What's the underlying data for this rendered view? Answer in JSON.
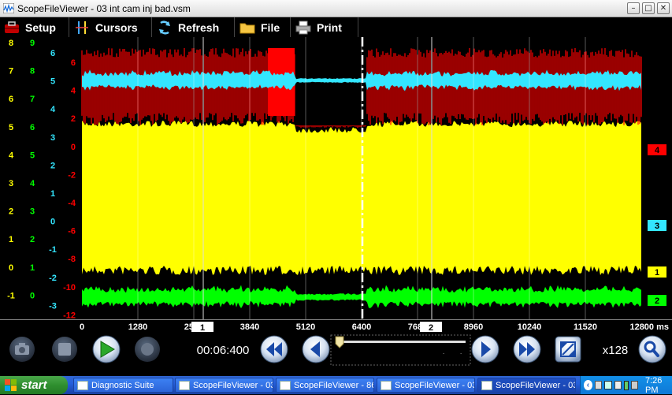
{
  "window": {
    "title": "ScopeFileViewer - 03 int cam inj bad.vsm"
  },
  "toolbar": {
    "setup": "Setup",
    "cursors": "Cursors",
    "refresh": "Refresh",
    "file": "File",
    "print": "Print"
  },
  "scales": {
    "col1": [
      "8",
      "7",
      "6",
      "5",
      "4",
      "3",
      "2",
      "1",
      "0",
      "-1"
    ],
    "col2": [
      "9",
      "8",
      "7",
      "6",
      "5",
      "4",
      "3",
      "2",
      "1",
      "0"
    ],
    "col3": [
      "6",
      "5",
      "4",
      "3",
      "2",
      "1",
      "0",
      "-1",
      "-2",
      "-3"
    ],
    "col4": [
      "6",
      "4",
      "2",
      "0",
      "-2",
      "-4",
      "-6",
      "-8",
      "-10",
      "-12"
    ]
  },
  "channel_markers": [
    "4",
    "3",
    "1",
    "2"
  ],
  "time_axis": {
    "ticks": [
      "0",
      "1280",
      "2560",
      "3840",
      "5120",
      "6400",
      "7680",
      "8960",
      "10240",
      "11520",
      "12800 ms"
    ]
  },
  "cursor_labels": [
    "1",
    "2"
  ],
  "playback": {
    "time": "00:06:400",
    "zoom": "x128"
  },
  "taskbar": {
    "start": "start",
    "tasks": [
      "Diagnostic Suite",
      "ScopeFileViewer - 03...",
      "ScopeFileViewer - 86...",
      "ScopeFileViewer - 03...",
      "ScopeFileViewer - 03..."
    ],
    "clock": "7:26 PM"
  },
  "colors": {
    "red": "#ff0000",
    "cyan": "#33e6ff",
    "yellow": "#ffff00",
    "green": "#00ff00"
  }
}
